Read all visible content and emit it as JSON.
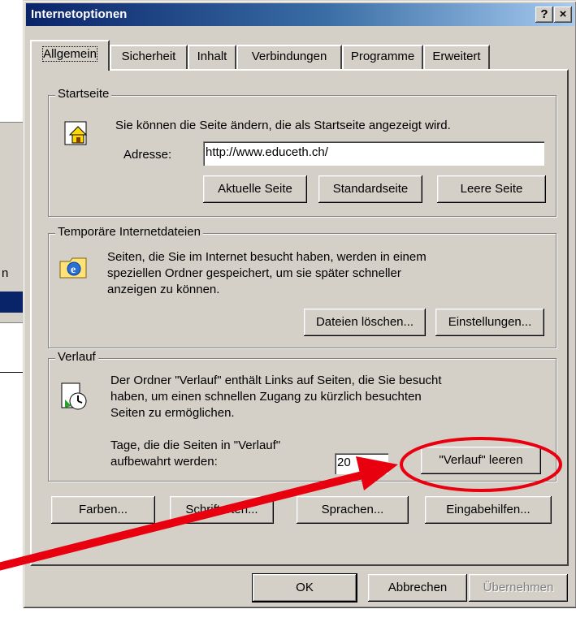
{
  "window": {
    "title": "Internetoptionen",
    "help_btn": "?",
    "close_btn": "×"
  },
  "background_window": {
    "fragment": "n"
  },
  "tabs": [
    {
      "label": "Allgemein",
      "active": true
    },
    {
      "label": "Sicherheit",
      "active": false
    },
    {
      "label": "Inhalt",
      "active": false
    },
    {
      "label": "Verbindungen",
      "active": false
    },
    {
      "label": "Programme",
      "active": false
    },
    {
      "label": "Erweitert",
      "active": false
    }
  ],
  "startseite": {
    "legend": "Startseite",
    "description": "Sie können die Seite ändern, die als Startseite angezeigt wird.",
    "address_label": "Adresse:",
    "address_value": "http://www.educeth.ch/",
    "btn_current": "Aktuelle Seite",
    "btn_default": "Standardseite",
    "btn_blank": "Leere Seite"
  },
  "temp_files": {
    "legend": "Temporäre Internetdateien",
    "description_line1": "Seiten, die Sie im  Internet besucht haben, werden in einem",
    "description_line2": "speziellen Ordner gespeichert, um sie später schneller",
    "description_line3": "anzeigen zu können.",
    "btn_delete": "Dateien löschen...",
    "btn_settings": "Einstellungen..."
  },
  "verlauf": {
    "legend": "Verlauf",
    "description_line1": "Der Ordner \"Verlauf\" enthält Links auf Seiten, die Sie besucht",
    "description_line2": "haben, um einen schnellen Zugang zu kürzlich besuchten",
    "description_line3": "Seiten zu ermöglichen.",
    "days_label_line1": "Tage, die die Seiten in \"Verlauf\"",
    "days_label_line2": "aufbewahrt werden:",
    "days_value": "20",
    "btn_clear": "\"Verlauf\" leeren"
  },
  "bottom_buttons": {
    "colors": "Farben...",
    "fonts": "Schriftarten...",
    "languages": "Sprachen...",
    "accessibility": "Eingabehilfen..."
  },
  "footer": {
    "ok": "OK",
    "cancel": "Abbrechen",
    "apply": "Übernehmen"
  },
  "annotation": {
    "color": "#e8000f"
  }
}
